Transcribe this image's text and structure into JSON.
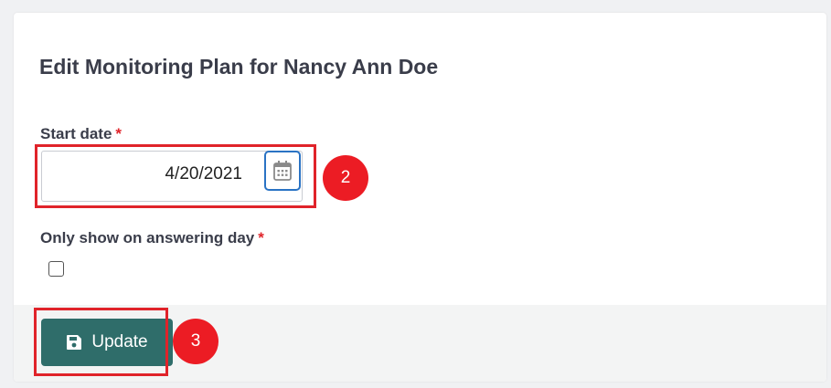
{
  "form": {
    "title": "Edit Monitoring Plan for Nancy Ann Doe",
    "start_date": {
      "label": "Start date",
      "required_marker": "*",
      "value": "4/20/2021",
      "picker_icon": "calendar-icon"
    },
    "answering_day": {
      "label": "Only show on answering day",
      "required_marker": "*",
      "checked": false
    }
  },
  "footer": {
    "update_label": "Update",
    "update_icon": "floppy-disk-icon"
  },
  "annotations": {
    "step_2": "2",
    "step_3": "3",
    "highlight_color": "#e0232a",
    "badge_color": "#ec1c24"
  },
  "colors": {
    "primary_button": "#2f6d6a",
    "required": "#e0242a",
    "focus_border": "#2a73c4"
  }
}
